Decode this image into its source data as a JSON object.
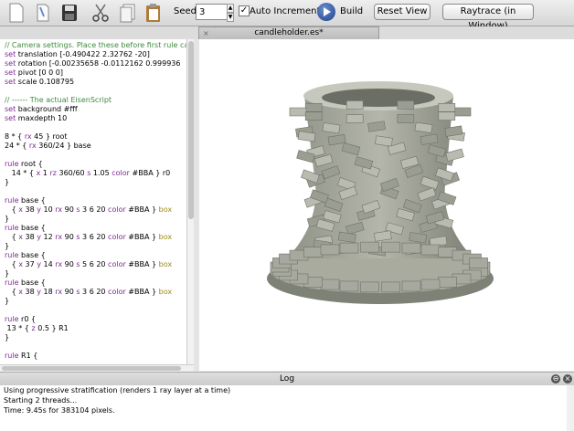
{
  "toolbar": {
    "seed_label": "Seed:",
    "seed_value": "3",
    "auto_increment_label": "Auto Increment",
    "build_label": "Build",
    "reset_view_label": "Reset View",
    "raytrace_label": "Raytrace (in Window)"
  },
  "tab": {
    "title": "candleholder.es*",
    "close": "×"
  },
  "editor": {
    "lines": [
      "// Camera settings. Place these before first rule ca",
      "set translation [-0.490422 2.32762 -20]",
      "set rotation [-0.00235658 -0.0112162 0.999936",
      "set pivot [0 0 0]",
      "set scale 0.108795",
      "",
      "// ------ The actual EisenScript",
      "set background #fff",
      "set maxdepth 10",
      "",
      "8 * { rx 45 } root",
      "24 * { rx 360/24 } base",
      "",
      "rule root {",
      "   14 * { x 1 rz 360/60 s 1.05 color #BBA } r0",
      "}",
      "",
      "rule base {",
      "   { x 38 y 10 rx 90 s 3 6 20 color #BBA } box",
      "}",
      "rule base {",
      "   { x 38 y 12 rx 90 s 3 6 20 color #BBA } box",
      "}",
      "rule base {",
      "   { x 37 y 14 rx 90 s 5 6 20 color #BBA } box",
      "}",
      "rule base {",
      "   { x 38 y 18 rx 90 s 3 6 20 color #BBA } box",
      "}",
      "",
      "rule r0 {",
      " 13 * { z 0.5 } R1",
      "}",
      "",
      "rule R1 {"
    ]
  },
  "log": {
    "title": "Log",
    "lines": [
      "Using progressive stratification (renders 1 ray layer at a time)",
      "Starting 2 threads...",
      "Time: 9.45s for 383104 pixels."
    ]
  },
  "colors": {
    "box": "#BBBBAA",
    "accent": "#1d3f8a"
  }
}
